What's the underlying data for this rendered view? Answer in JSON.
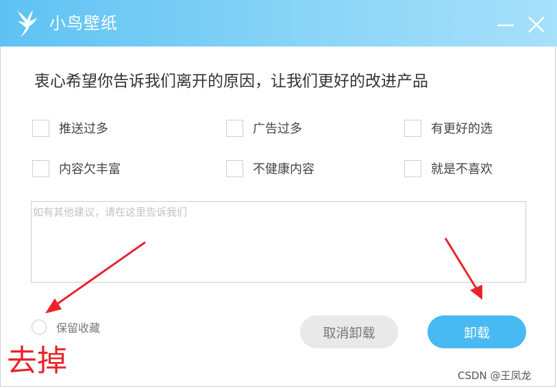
{
  "window": {
    "title": "小鸟壁纸",
    "logo_icon": "bird-logo-icon",
    "minimize_icon": "minimize-icon",
    "close_icon": "close-icon"
  },
  "survey": {
    "heading": "衷心希望你告诉我们离开的原因，让我们更好的改进产品",
    "options": [
      "推送过多",
      "广告过多",
      "有更好的选",
      "内容欠丰富",
      "不健康内容",
      "就是不喜欢"
    ],
    "suggestion_placeholder": "如有其他建议，请在这里告诉我们"
  },
  "footer": {
    "keep_favorites_label": "保留收藏",
    "cancel_label": "取消卸载",
    "uninstall_label": "卸载"
  },
  "annotation": {
    "text": "去掉",
    "color": "#e8242a"
  },
  "watermark": "CSDN @王凤龙",
  "colors": {
    "titlebar_start": "#5ec2f3",
    "titlebar_end": "#a6e0fb",
    "primary_button": "#49b9f2",
    "secondary_button": "#e9e9e9"
  }
}
